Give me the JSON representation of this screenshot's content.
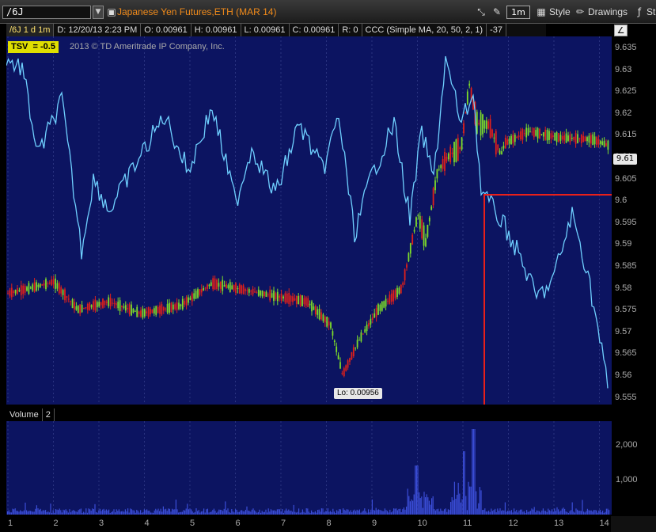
{
  "toolbar": {
    "symbol": "/6J",
    "title": "Japanese Yen Futures,ETH (MAR 14)",
    "aggregation": "1m",
    "style_label": "Style",
    "drawings_label": "Drawings",
    "studies_label": "St"
  },
  "infobar": {
    "symbol_period": "/6J 1 d 1m",
    "date": "D: 12/20/13 2:23 PM",
    "open": "O: 0.00961",
    "high": "H: 0.00961",
    "low": "L: 0.00961",
    "close": "C: 0.00961",
    "range": "R: 0",
    "study": "CCC (Simple MA, 20, 50, 2, 1)",
    "study_value": "-37"
  },
  "chart": {
    "tsv_label": "TSV",
    "tsv_value": "= -0.5",
    "copyright": "2013 © TD Ameritrade IP Company, Inc.",
    "price_tag": "9.61",
    "low_label": "Lo: 0.00956",
    "y_ticks": [
      "9.635",
      "9.63",
      "9.625",
      "9.62",
      "9.615",
      "9.61",
      "9.605",
      "9.6",
      "9.595",
      "9.59",
      "9.585",
      "9.58",
      "9.575",
      "9.57",
      "9.565",
      "9.56",
      "9.555"
    ],
    "highlight_color": "#e8201a",
    "up_color": "#7ddc2a",
    "down_color": "#e0201a",
    "line_color": "#6fd0ff"
  },
  "volume": {
    "label": "Volume",
    "value": "2",
    "ticks": [
      "2,000",
      "1,000"
    ]
  },
  "xaxis": {
    "labels": [
      "1",
      "2",
      "3",
      "4",
      "5",
      "6",
      "7",
      "8",
      "9",
      "10",
      "11",
      "12",
      "13",
      "14"
    ]
  }
}
